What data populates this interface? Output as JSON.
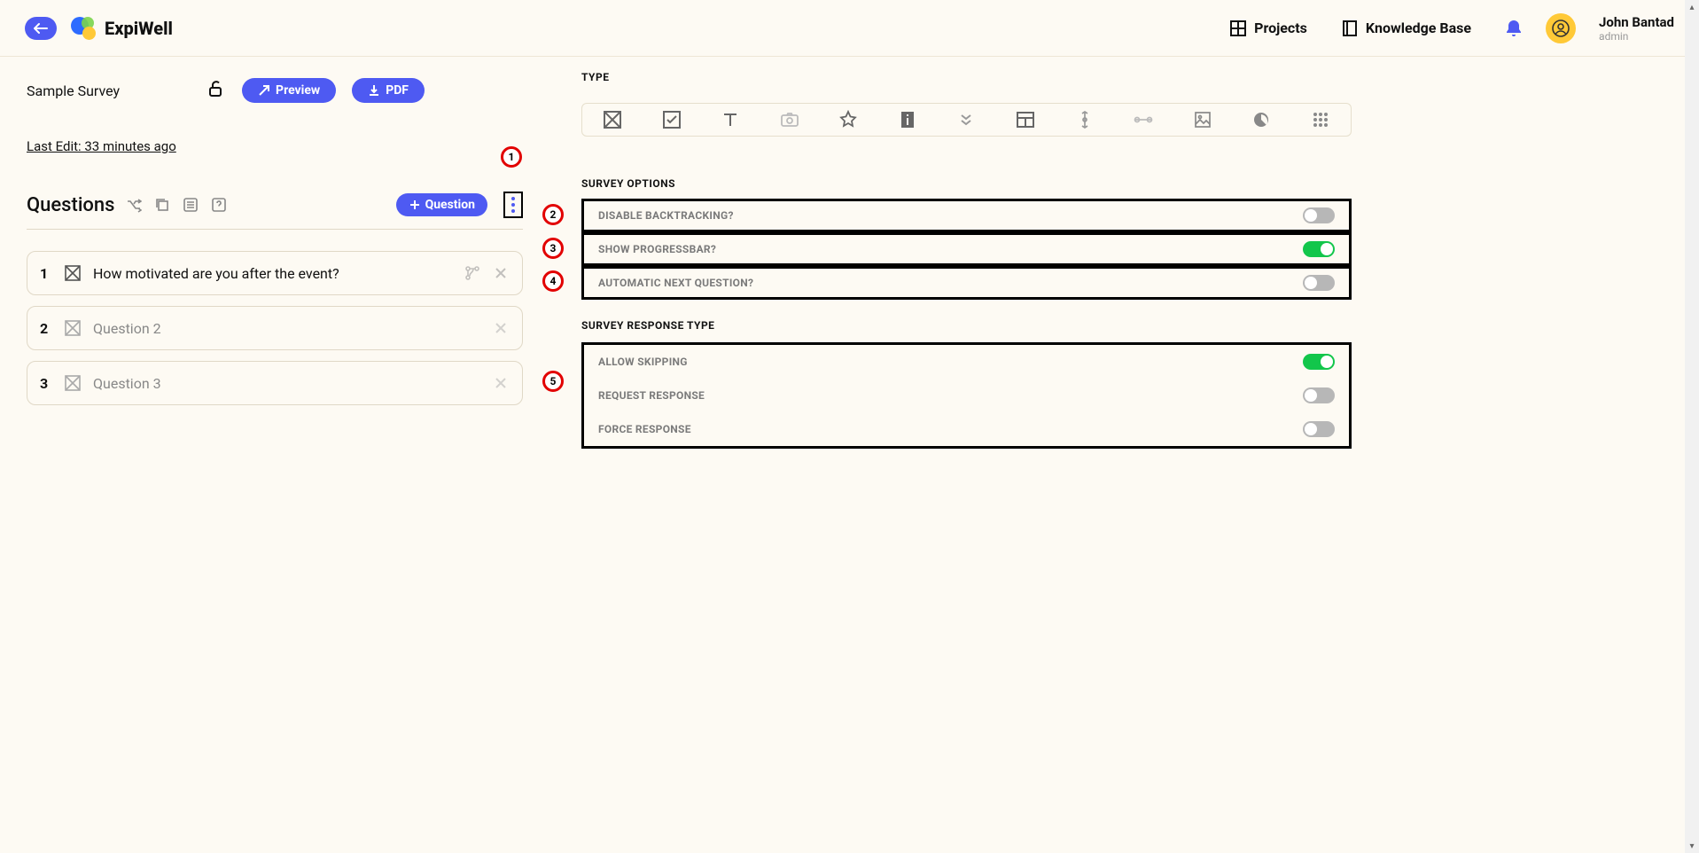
{
  "header": {
    "brand": "ExpiWell",
    "nav": {
      "projects": "Projects",
      "knowledge_base": "Knowledge Base"
    },
    "user": {
      "name": "John Bantad",
      "role": "admin"
    }
  },
  "left": {
    "survey_title": "Sample Survey",
    "preview_label": "Preview",
    "pdf_label": "PDF",
    "last_edit": "Last Edit: 33 minutes ago",
    "questions_heading": "Questions",
    "add_question_label": "Question",
    "questions": [
      {
        "num": "1",
        "text": "How motivated are you after the event?",
        "active": true,
        "branch": true
      },
      {
        "num": "2",
        "text": "Question 2",
        "active": false,
        "branch": false
      },
      {
        "num": "3",
        "text": "Question 3",
        "active": false,
        "branch": false
      }
    ]
  },
  "right": {
    "type_label": "TYPE",
    "survey_options_label": "SURVEY OPTIONS",
    "options": {
      "disable_backtracking": {
        "label": "DISABLE BACKTRACKING?",
        "on": false
      },
      "show_progressbar": {
        "label": "SHOW PROGRESSBAR?",
        "on": true
      },
      "auto_next": {
        "label": "AUTOMATIC NEXT QUESTION?",
        "on": false
      }
    },
    "response_type_label": "SURVEY RESPONSE TYPE",
    "response": {
      "allow_skipping": {
        "label": "ALLOW SKIPPING",
        "on": true
      },
      "request_response": {
        "label": "REQUEST RESPONSE",
        "on": false
      },
      "force_response": {
        "label": "FORCE RESPONSE",
        "on": false
      }
    }
  },
  "callouts": {
    "c1": "1",
    "c2": "2",
    "c3": "3",
    "c4": "4",
    "c5": "5"
  }
}
